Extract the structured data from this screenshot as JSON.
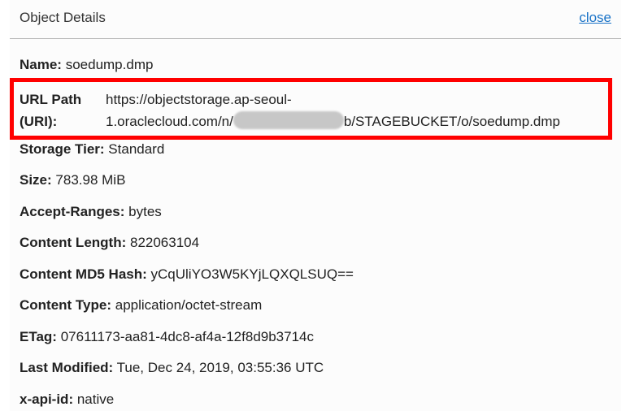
{
  "header": {
    "title": "Object Details",
    "close_label": "close"
  },
  "details": {
    "name": {
      "label": "Name:",
      "value": "soedump.dmp"
    },
    "url": {
      "label_line1": "URL Path",
      "label_line2": "(URI):",
      "value_line1": "https://objectstorage.ap-seoul-",
      "value_line2_prefix": "1.oraclecloud.com/n/",
      "value_line2_suffix": "b/STAGEBUCKET/o/soedump.dmp"
    },
    "storage_tier": {
      "label": "Storage Tier:",
      "value": "Standard"
    },
    "size": {
      "label": "Size:",
      "value": "783.98 MiB"
    },
    "accept_ranges": {
      "label": "Accept-Ranges:",
      "value": "bytes"
    },
    "content_length": {
      "label": "Content Length:",
      "value": "822063104"
    },
    "content_md5": {
      "label": "Content MD5 Hash:",
      "value": "yCqUliYO3W5KYjLQXQLSUQ=="
    },
    "content_type": {
      "label": "Content Type:",
      "value": "application/octet-stream"
    },
    "etag": {
      "label": "ETag:",
      "value": "07611173-aa81-4dc8-af4a-12f8d9b3714c"
    },
    "last_modified": {
      "label": "Last Modified:",
      "value": "Tue, Dec 24, 2019, 03:55:36 UTC"
    },
    "x_api_id": {
      "label": "x-api-id:",
      "value": "native"
    }
  },
  "colors": {
    "highlight": "#ff0000",
    "link": "#1a73c7"
  }
}
